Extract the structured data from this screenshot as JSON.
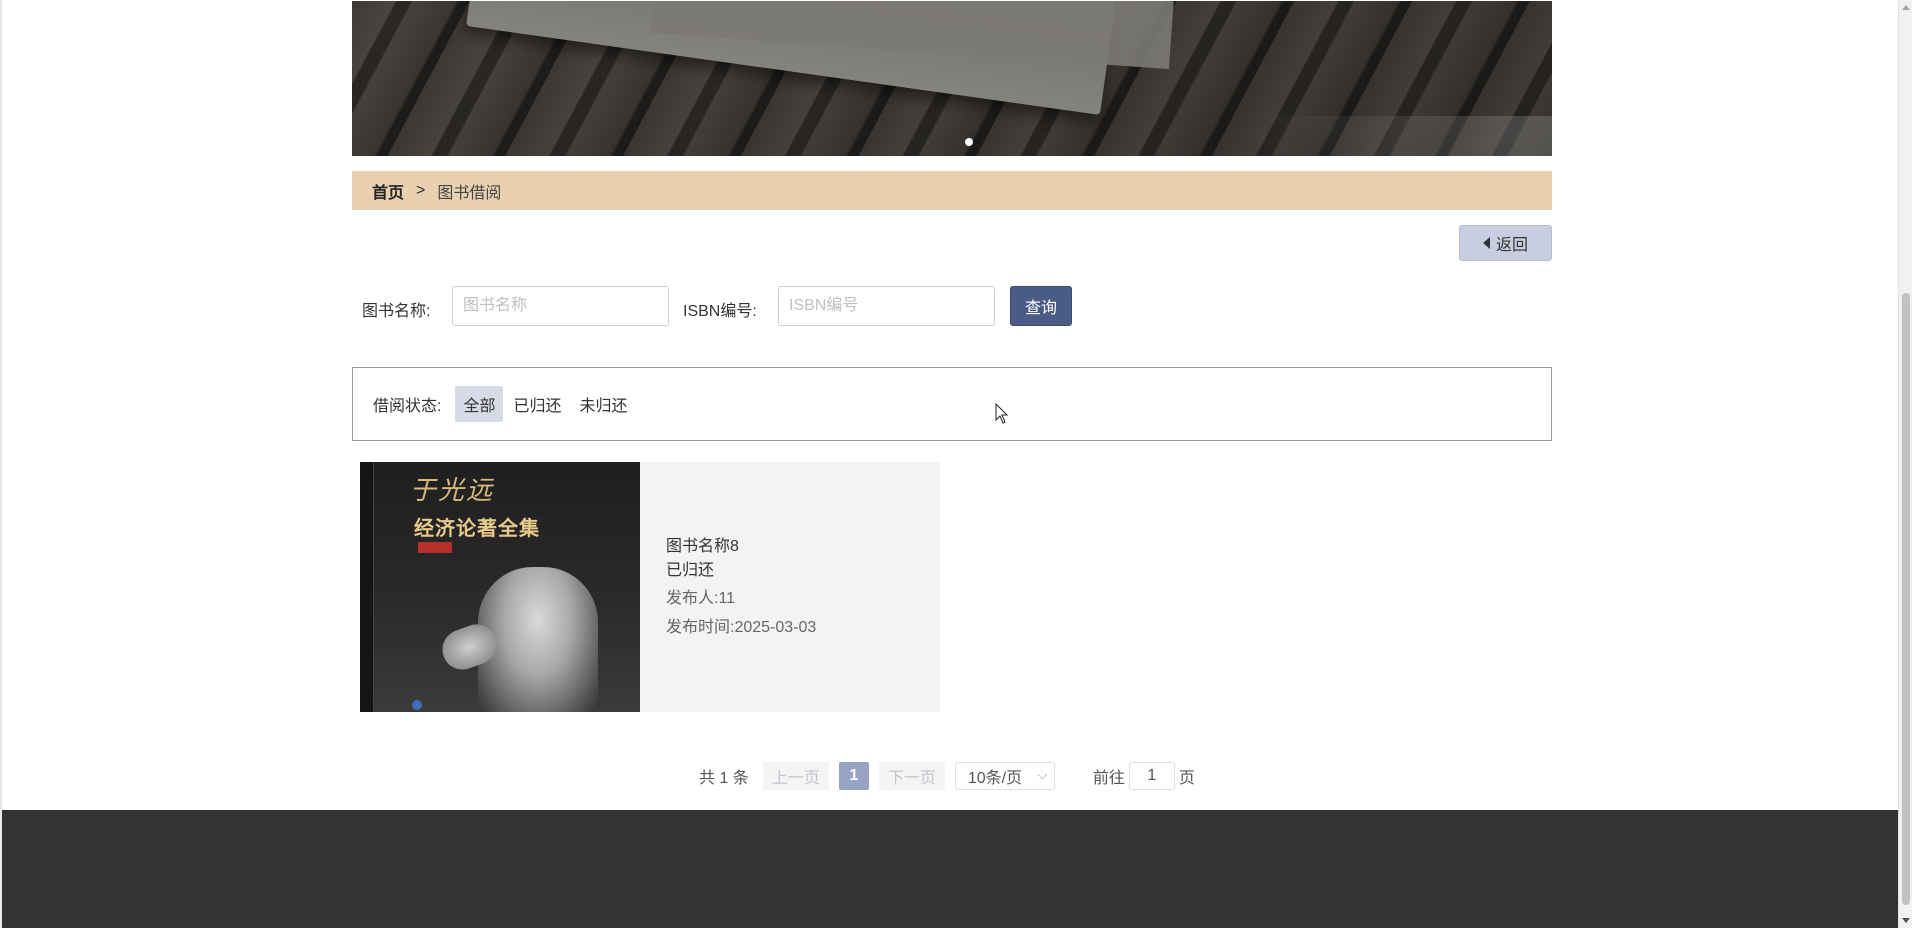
{
  "breadcrumb": {
    "home": "首页",
    "separator": ">",
    "current": "图书借阅"
  },
  "actions": {
    "back_label": "返回",
    "back_icon": "caret-left-icon"
  },
  "search": {
    "book_name_label": "图书名称:",
    "book_name_placeholder": "图书名称",
    "book_name_value": "",
    "isbn_label": "ISBN编号:",
    "isbn_placeholder": "ISBN编号",
    "isbn_value": "",
    "query_label": "查询"
  },
  "filter": {
    "label": "借阅状态:",
    "options": [
      "全部",
      "已归还",
      "未归还"
    ],
    "selected": "全部"
  },
  "books": [
    {
      "name": "图书名称8",
      "status": "已归还",
      "publisher": "发布人:11",
      "publish_time": "发布时间:2025-03-03",
      "cover": {
        "signature": "于光远",
        "title": "经济论著全集"
      }
    }
  ],
  "pagination": {
    "total": "共 1 条",
    "prev": "上一页",
    "current_page": "1",
    "next": "下一页",
    "page_size": "10条/页",
    "goto_prefix": "前往",
    "goto_value": "1",
    "goto_suffix": "页"
  },
  "colors": {
    "breadcrumb_bg": "#e9d0b1",
    "primary_button": "#4a5b86",
    "active_page": "#97a3c4",
    "footer_bg": "#333333"
  }
}
